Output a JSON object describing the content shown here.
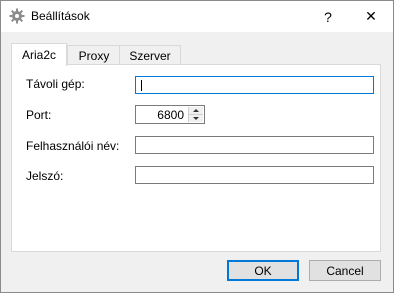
{
  "window": {
    "title": "Beállítások",
    "icon": "gear-icon",
    "help_glyph": "?",
    "close_glyph": "✕"
  },
  "tabs": [
    {
      "label": "Aria2c",
      "active": true
    },
    {
      "label": "Proxy",
      "active": false
    },
    {
      "label": "Szerver",
      "active": false
    }
  ],
  "form": {
    "remote_host": {
      "label": "Távoli gép:",
      "value": ""
    },
    "port": {
      "label": "Port:",
      "value": "6800"
    },
    "username": {
      "label": "Felhasználói név:",
      "value": ""
    },
    "password": {
      "label": "Jelszó:",
      "value": ""
    }
  },
  "buttons": {
    "ok": "OK",
    "cancel": "Cancel"
  },
  "colors": {
    "accent": "#0078d7",
    "dialog_bg": "#f0f0f0",
    "panel_bg": "#ffffff"
  }
}
